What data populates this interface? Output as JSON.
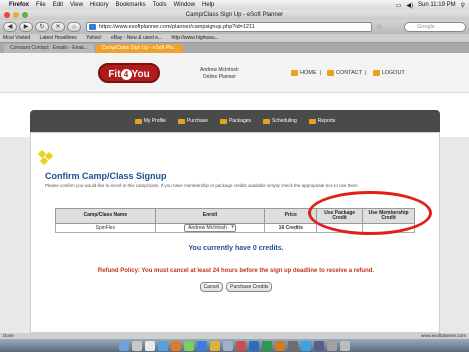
{
  "menubar": {
    "app": "Firefox",
    "items": [
      "File",
      "Edit",
      "View",
      "History",
      "Bookmarks",
      "Tools",
      "Window",
      "Help"
    ],
    "clock": "Sun 11:19 PM"
  },
  "window": {
    "title": "Camp/Class Sign Up - eSoft Planner"
  },
  "toolbar": {
    "url": "https://www.esoftplanner.com/planner/campsignup.php?id=1211",
    "search_placeholder": "Google"
  },
  "bookmarks": [
    "Most Visited",
    "Latest Headlines",
    "Yahoo!",
    "eBay - New & used e...",
    "http://www.highwau..."
  ],
  "tabs": [
    {
      "label": "Constant Contact : Emails - Emai...",
      "active": false
    },
    {
      "label": "Camp/Class Sign Up - eSoft Pla...",
      "active": true
    }
  ],
  "site": {
    "logo_left": "Fit",
    "logo_mid": "4",
    "logo_right": "You",
    "user_name": "Andrew McIntosh",
    "user_sub": "Online Planner",
    "links": [
      "HOME",
      "CONTACT",
      "LOGOUT"
    ],
    "nav": [
      "My Profile",
      "Purchase",
      "Packages",
      "Scheduling",
      "Reports"
    ]
  },
  "main": {
    "title": "Confirm Camp/Class Signup",
    "intro": "Please confirm you would like to enroll in this camp/class. If you have membership or package credits available simply check the appropriate box to use them.",
    "table": {
      "headers": [
        "Camp/Class Name",
        "Enroll",
        "Price",
        "Use Package Credit",
        "Use Membership Credit"
      ],
      "rows": [
        {
          "name": "SpinFlex",
          "enroll": "Andrew McIntosh",
          "price": "16 Credits",
          "package": "",
          "membership": ""
        }
      ]
    },
    "credits_message": "You currently have 0 credits.",
    "refund_policy": "Refund Policy: You must cancel at least 24 hours before the sign up deadline to receive a refund.",
    "buttons": [
      "Cancel",
      "Purchase Credits"
    ]
  },
  "status": {
    "left": "Done",
    "right": "www.esoftplanner.com"
  },
  "colors": {
    "brand_red": "#b01c1c",
    "title_blue": "#1f4f96",
    "refund_red": "#c0331c",
    "highlight": "#e0201a",
    "nav_dark": "#4a4a48",
    "accent_orange": "#e9a21f"
  }
}
